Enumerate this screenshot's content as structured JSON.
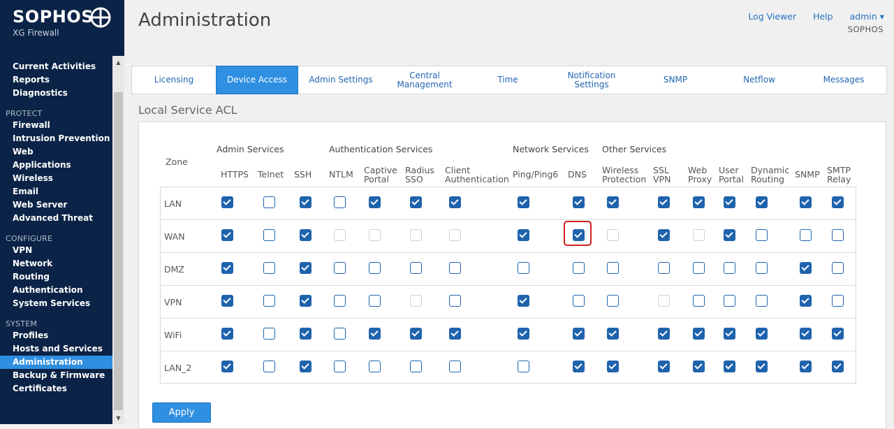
{
  "brand": {
    "name": "SOPHOS",
    "product": "XG Firewall"
  },
  "header": {
    "title": "Administration",
    "links": [
      "Log Viewer",
      "Help",
      "admin ▾"
    ],
    "organization": "SOPHOS"
  },
  "nav": {
    "groups": [
      {
        "label": "",
        "items": [
          "Current Activities",
          "Reports",
          "Diagnostics"
        ]
      },
      {
        "label": "PROTECT",
        "items": [
          "Firewall",
          "Intrusion Prevention",
          "Web",
          "Applications",
          "Wireless",
          "Email",
          "Web Server",
          "Advanced Threat"
        ]
      },
      {
        "label": "CONFIGURE",
        "items": [
          "VPN",
          "Network",
          "Routing",
          "Authentication",
          "System Services"
        ]
      },
      {
        "label": "SYSTEM",
        "items": [
          "Profiles",
          "Hosts and Services",
          "Administration",
          "Backup & Firmware",
          "Certificates"
        ]
      }
    ],
    "active": "Administration"
  },
  "tabs": {
    "items": [
      "Licensing",
      "Device Access",
      "Admin Settings",
      "Central\nManagement",
      "Time",
      "Notification\nSettings",
      "SNMP",
      "Netflow",
      "Messages"
    ],
    "active": "Device Access"
  },
  "section_title": "Local Service ACL",
  "acl": {
    "zone_header": "Zone",
    "groups": [
      {
        "label": "Admin Services"
      },
      {
        "label": "Authentication Services"
      },
      {
        "label": "Network Services"
      },
      {
        "label": "Other Services"
      }
    ],
    "services": [
      "HTTPS",
      "Telnet",
      "SSH",
      "NTLM",
      "Captive\nPortal",
      "Radius\nSSO",
      "Client\nAuthentication",
      "Ping/Ping6",
      "DNS",
      "Wireless\nProtection",
      "SSL\nVPN",
      "Web\nProxy",
      "User\nPortal",
      "Dynamic\nRouting",
      "SNMP",
      "SMTP\nRelay"
    ],
    "state_legend": {
      "1": "checked",
      "0": "unchecked",
      "-1": "disabled"
    },
    "rows": [
      {
        "zone": "LAN",
        "states": [
          1,
          0,
          1,
          0,
          1,
          1,
          1,
          1,
          1,
          1,
          1,
          1,
          1,
          1,
          1,
          1
        ]
      },
      {
        "zone": "WAN",
        "states": [
          1,
          0,
          1,
          -1,
          -1,
          -1,
          -1,
          1,
          1,
          -1,
          1,
          -1,
          1,
          0,
          0,
          0
        ]
      },
      {
        "zone": "DMZ",
        "states": [
          1,
          0,
          1,
          0,
          0,
          0,
          0,
          0,
          0,
          0,
          0,
          0,
          0,
          0,
          1,
          0
        ]
      },
      {
        "zone": "VPN",
        "states": [
          1,
          0,
          1,
          0,
          0,
          -1,
          0,
          1,
          0,
          0,
          -1,
          0,
          0,
          0,
          1,
          0
        ]
      },
      {
        "zone": "WiFi",
        "states": [
          1,
          0,
          1,
          0,
          1,
          1,
          1,
          1,
          1,
          1,
          1,
          1,
          1,
          1,
          1,
          1
        ]
      },
      {
        "zone": "LAN_2",
        "states": [
          1,
          0,
          1,
          0,
          0,
          0,
          0,
          0,
          1,
          1,
          1,
          1,
          1,
          1,
          1,
          1
        ]
      }
    ],
    "highlighted": {
      "zone": "WAN",
      "service": "DNS"
    }
  },
  "apply_label": "Apply"
}
